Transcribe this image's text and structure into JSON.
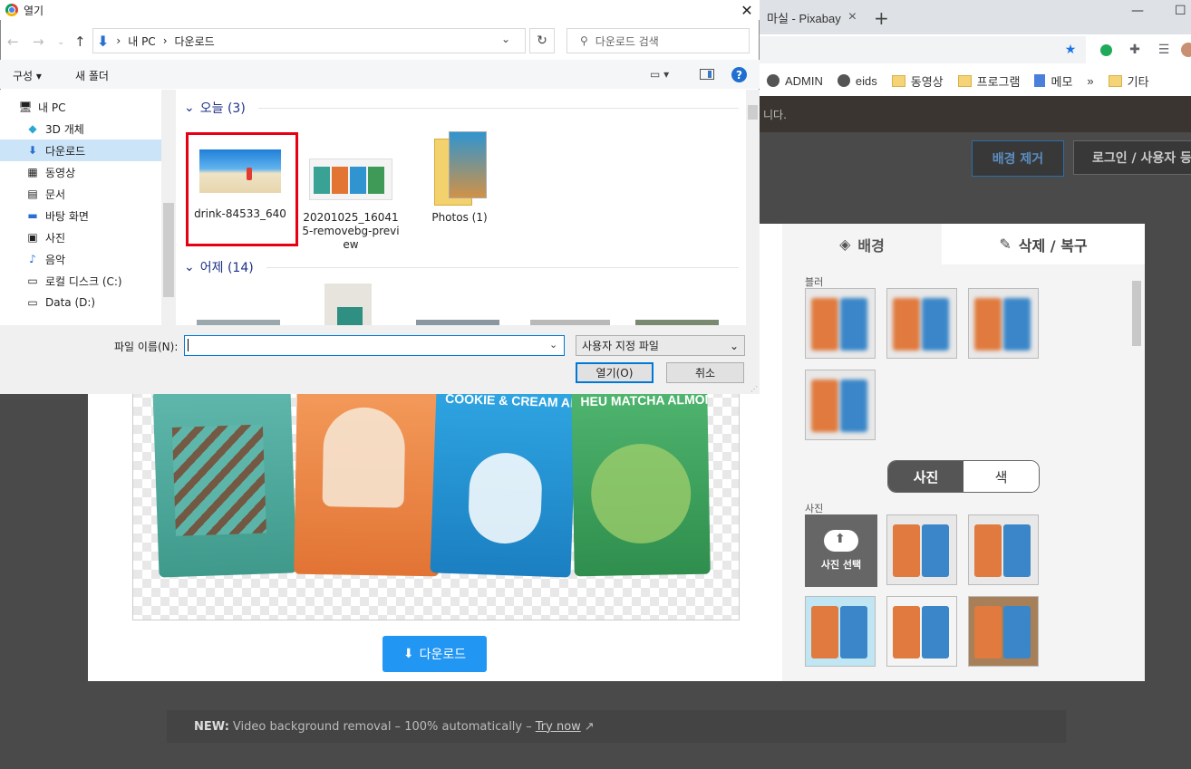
{
  "browser": {
    "tab_title": "마실 - Pixabay",
    "tab_close": "×",
    "new_tab": "+",
    "minimize": "—",
    "maximize": "☐",
    "bookmarks": [
      {
        "label": "ADMIN",
        "icon": "globe-icon"
      },
      {
        "label": "eids",
        "icon": "globe-icon"
      },
      {
        "label": "동영상",
        "icon": "folder-icon"
      },
      {
        "label": "프로그램",
        "icon": "folder-icon"
      },
      {
        "label": "메모",
        "icon": "doc-icon"
      },
      {
        "label": "»",
        "icon": ""
      },
      {
        "label": "기타",
        "icon": "folder-icon"
      }
    ],
    "notice_suffix": "니다."
  },
  "site": {
    "remove_bg_button": "배경 제거",
    "login_button": "로그인 / 사용자 등",
    "footer_new": "NEW:",
    "footer_text": "Video background removal – 100% automatically –",
    "footer_link": "Try now"
  },
  "editor": {
    "download_button": "다운로드",
    "tab_background": "배경",
    "tab_erase": "삭제 / 복구",
    "blur_label": "블러",
    "segment_photo": "사진",
    "segment_color": "색",
    "photo_label": "사진",
    "upload_tile": "사진 선택",
    "bag_labels": [
      "",
      "",
      "COOKIE & CREAM ALMOND",
      "HEU MATCHA ALMOND"
    ]
  },
  "dialog": {
    "title": "열기",
    "close": "✕",
    "address": [
      "내 PC",
      "다운로드"
    ],
    "search_placeholder": "다운로드 검색",
    "organize": "구성 ▾",
    "new_folder": "새 폴더",
    "nav_items": [
      {
        "label": "내 PC",
        "icon": "computer-icon",
        "selected": false
      },
      {
        "label": "3D 개체",
        "icon": "cube-icon",
        "selected": false
      },
      {
        "label": "다운로드",
        "icon": "download-arrow-icon",
        "selected": true
      },
      {
        "label": "동영상",
        "icon": "film-icon",
        "selected": false
      },
      {
        "label": "문서",
        "icon": "document-icon",
        "selected": false
      },
      {
        "label": "바탕 화면",
        "icon": "desktop-icon",
        "selected": false
      },
      {
        "label": "사진",
        "icon": "picture-icon",
        "selected": false
      },
      {
        "label": "음악",
        "icon": "music-icon",
        "selected": false
      },
      {
        "label": "로컬 디스크 (C:)",
        "icon": "drive-icon",
        "selected": false
      },
      {
        "label": "Data (D:)",
        "icon": "drive-icon",
        "selected": false
      }
    ],
    "groups": [
      {
        "label": "오늘 (3)"
      },
      {
        "label": "어제 (14)"
      }
    ],
    "files_today": [
      {
        "name": "drink-84533_640",
        "selected": true
      },
      {
        "name": "20201025_160415-removebg-preview",
        "selected": false
      },
      {
        "name": "Photos (1)",
        "selected": false
      }
    ],
    "filename_label": "파일 이름(N):",
    "filename_value": "",
    "filetype": "사용자 지정 파일",
    "open_button": "열기(O)",
    "cancel_button": "취소"
  },
  "colors": {
    "accent_blue": "#2196f3",
    "selection_red": "#e60012",
    "nav_selected": "#cce4f7"
  }
}
